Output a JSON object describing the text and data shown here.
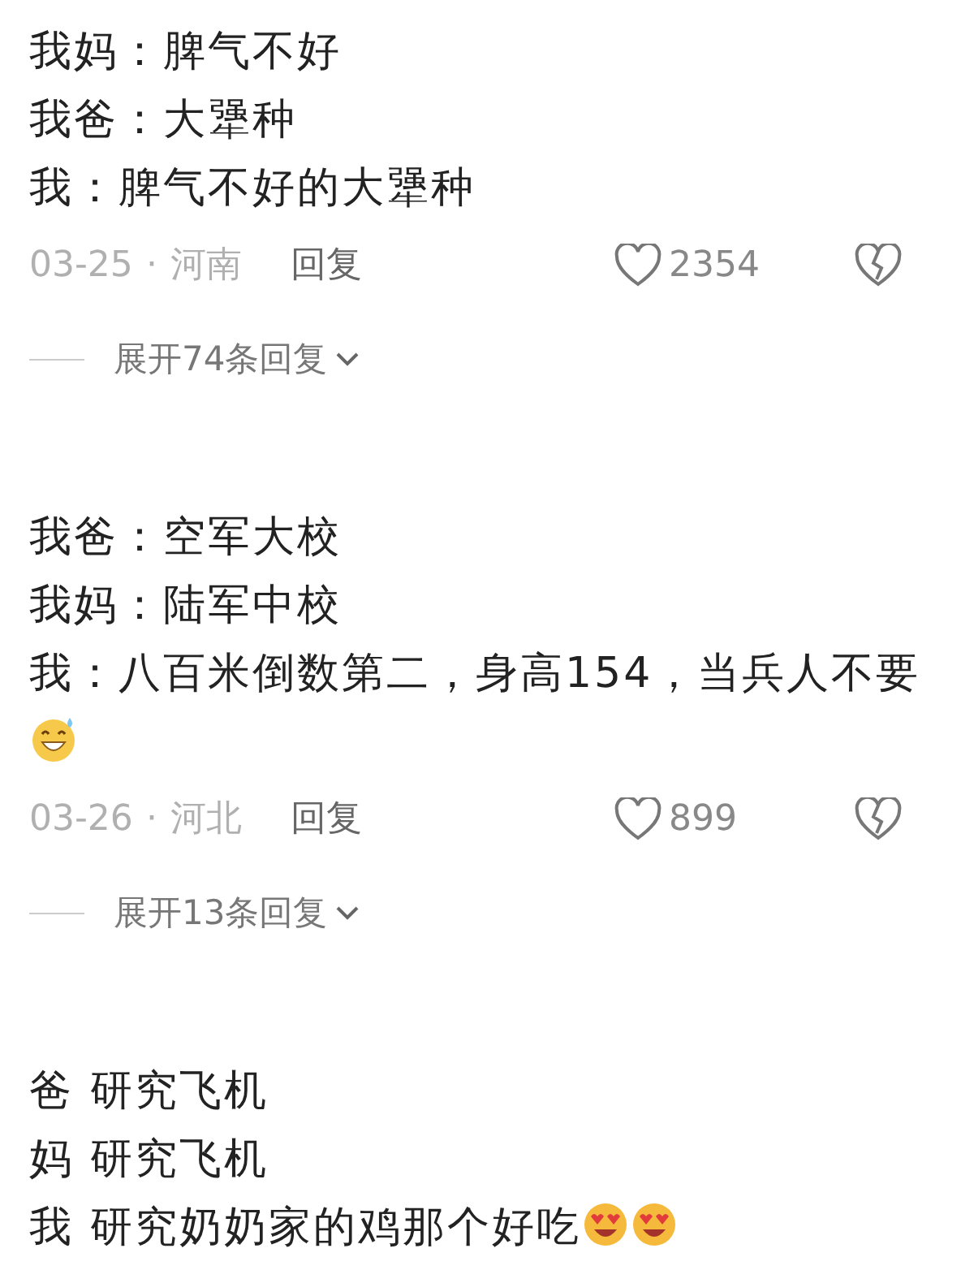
{
  "comments": [
    {
      "lines": [
        {
          "text": "我妈：脾气不好"
        },
        {
          "text": "我爸：大犟种"
        },
        {
          "text": "我：脾气不好的大犟种"
        }
      ],
      "meta": {
        "date": "03-25",
        "separator": "·",
        "region": "河南",
        "reply": "回复",
        "likes": "2354"
      },
      "expand": "展开74条回复"
    },
    {
      "lines": [
        {
          "text": "我爸：空军大校"
        },
        {
          "text": "我妈：陆军中校"
        },
        {
          "text": "我：八百米倒数第二，身高154，当兵人不要",
          "emojis": [
            {
              "kind": "grin-sweat"
            }
          ]
        }
      ],
      "meta": {
        "date": "03-26",
        "separator": "·",
        "region": "河北",
        "reply": "回复",
        "likes": "899"
      },
      "expand": "展开13条回复"
    },
    {
      "lines": [
        {
          "text": "爸 研究飞机"
        },
        {
          "text": "妈 研究飞机"
        },
        {
          "text": "我 研究奶奶家的鸡那个好吃",
          "emojis": [
            {
              "kind": "heart-eyes"
            },
            {
              "kind": "heart-eyes"
            }
          ]
        }
      ]
    }
  ]
}
